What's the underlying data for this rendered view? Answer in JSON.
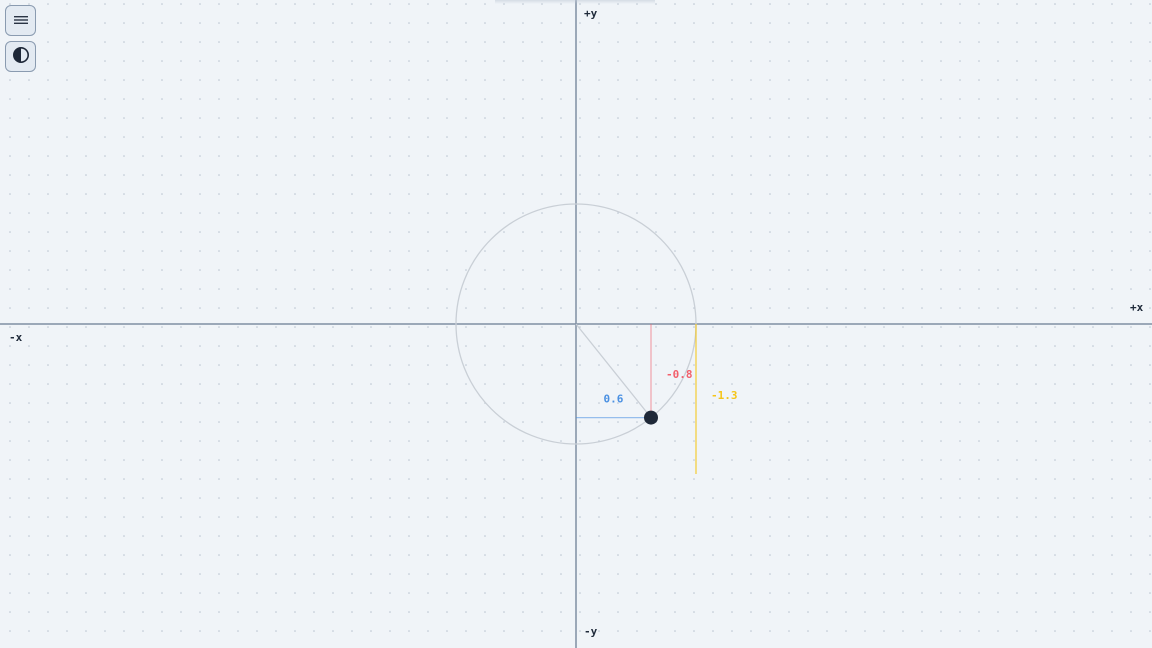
{
  "toolbar": {
    "menu_icon": "hamburger-menu-icon",
    "theme_icon": "contrast-half-circle-icon"
  },
  "axes": {
    "pos_x": "+x",
    "neg_x": "-x",
    "pos_y": "+y",
    "neg_y": "-y"
  },
  "unit_circle": {
    "radius": 1,
    "point": {
      "x": 0.625,
      "y": -0.78
    }
  },
  "values": {
    "cos_label": "0.6",
    "sin_label": "-0.8",
    "tan_label": "-1.3"
  },
  "colors": {
    "background": "#f0f4f8",
    "axis": "#7f8ea3",
    "grid_dot": "#b9c3cf",
    "circle": "#c9cfd6",
    "cos": "#4a90e2",
    "sin": "#f25f6b",
    "tan": "#f5c518",
    "point": "#1e2838"
  }
}
